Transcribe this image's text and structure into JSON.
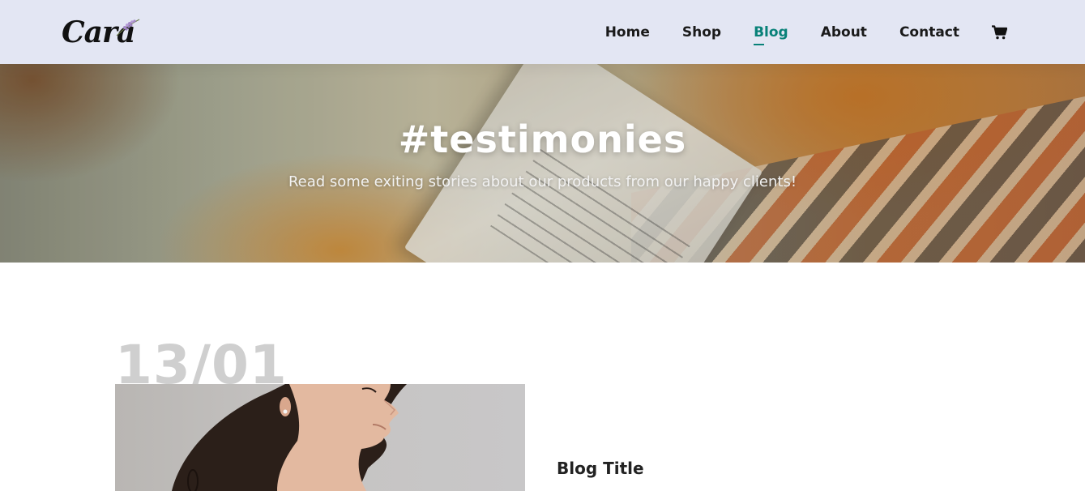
{
  "brand": {
    "logo_text": "Cara"
  },
  "nav": {
    "items": [
      {
        "label": "Home",
        "active": false
      },
      {
        "label": "Shop",
        "active": false
      },
      {
        "label": "Blog",
        "active": true
      },
      {
        "label": "About",
        "active": false
      },
      {
        "label": "Contact",
        "active": false
      }
    ],
    "cart_icon": "cart-icon",
    "accent_color": "#088178"
  },
  "hero": {
    "title": "#testimonies",
    "subtitle": "Read some exiting stories about our products from our happy clients!"
  },
  "blog": {
    "posts": [
      {
        "date": "13/01",
        "title": "Blog Title"
      }
    ]
  }
}
